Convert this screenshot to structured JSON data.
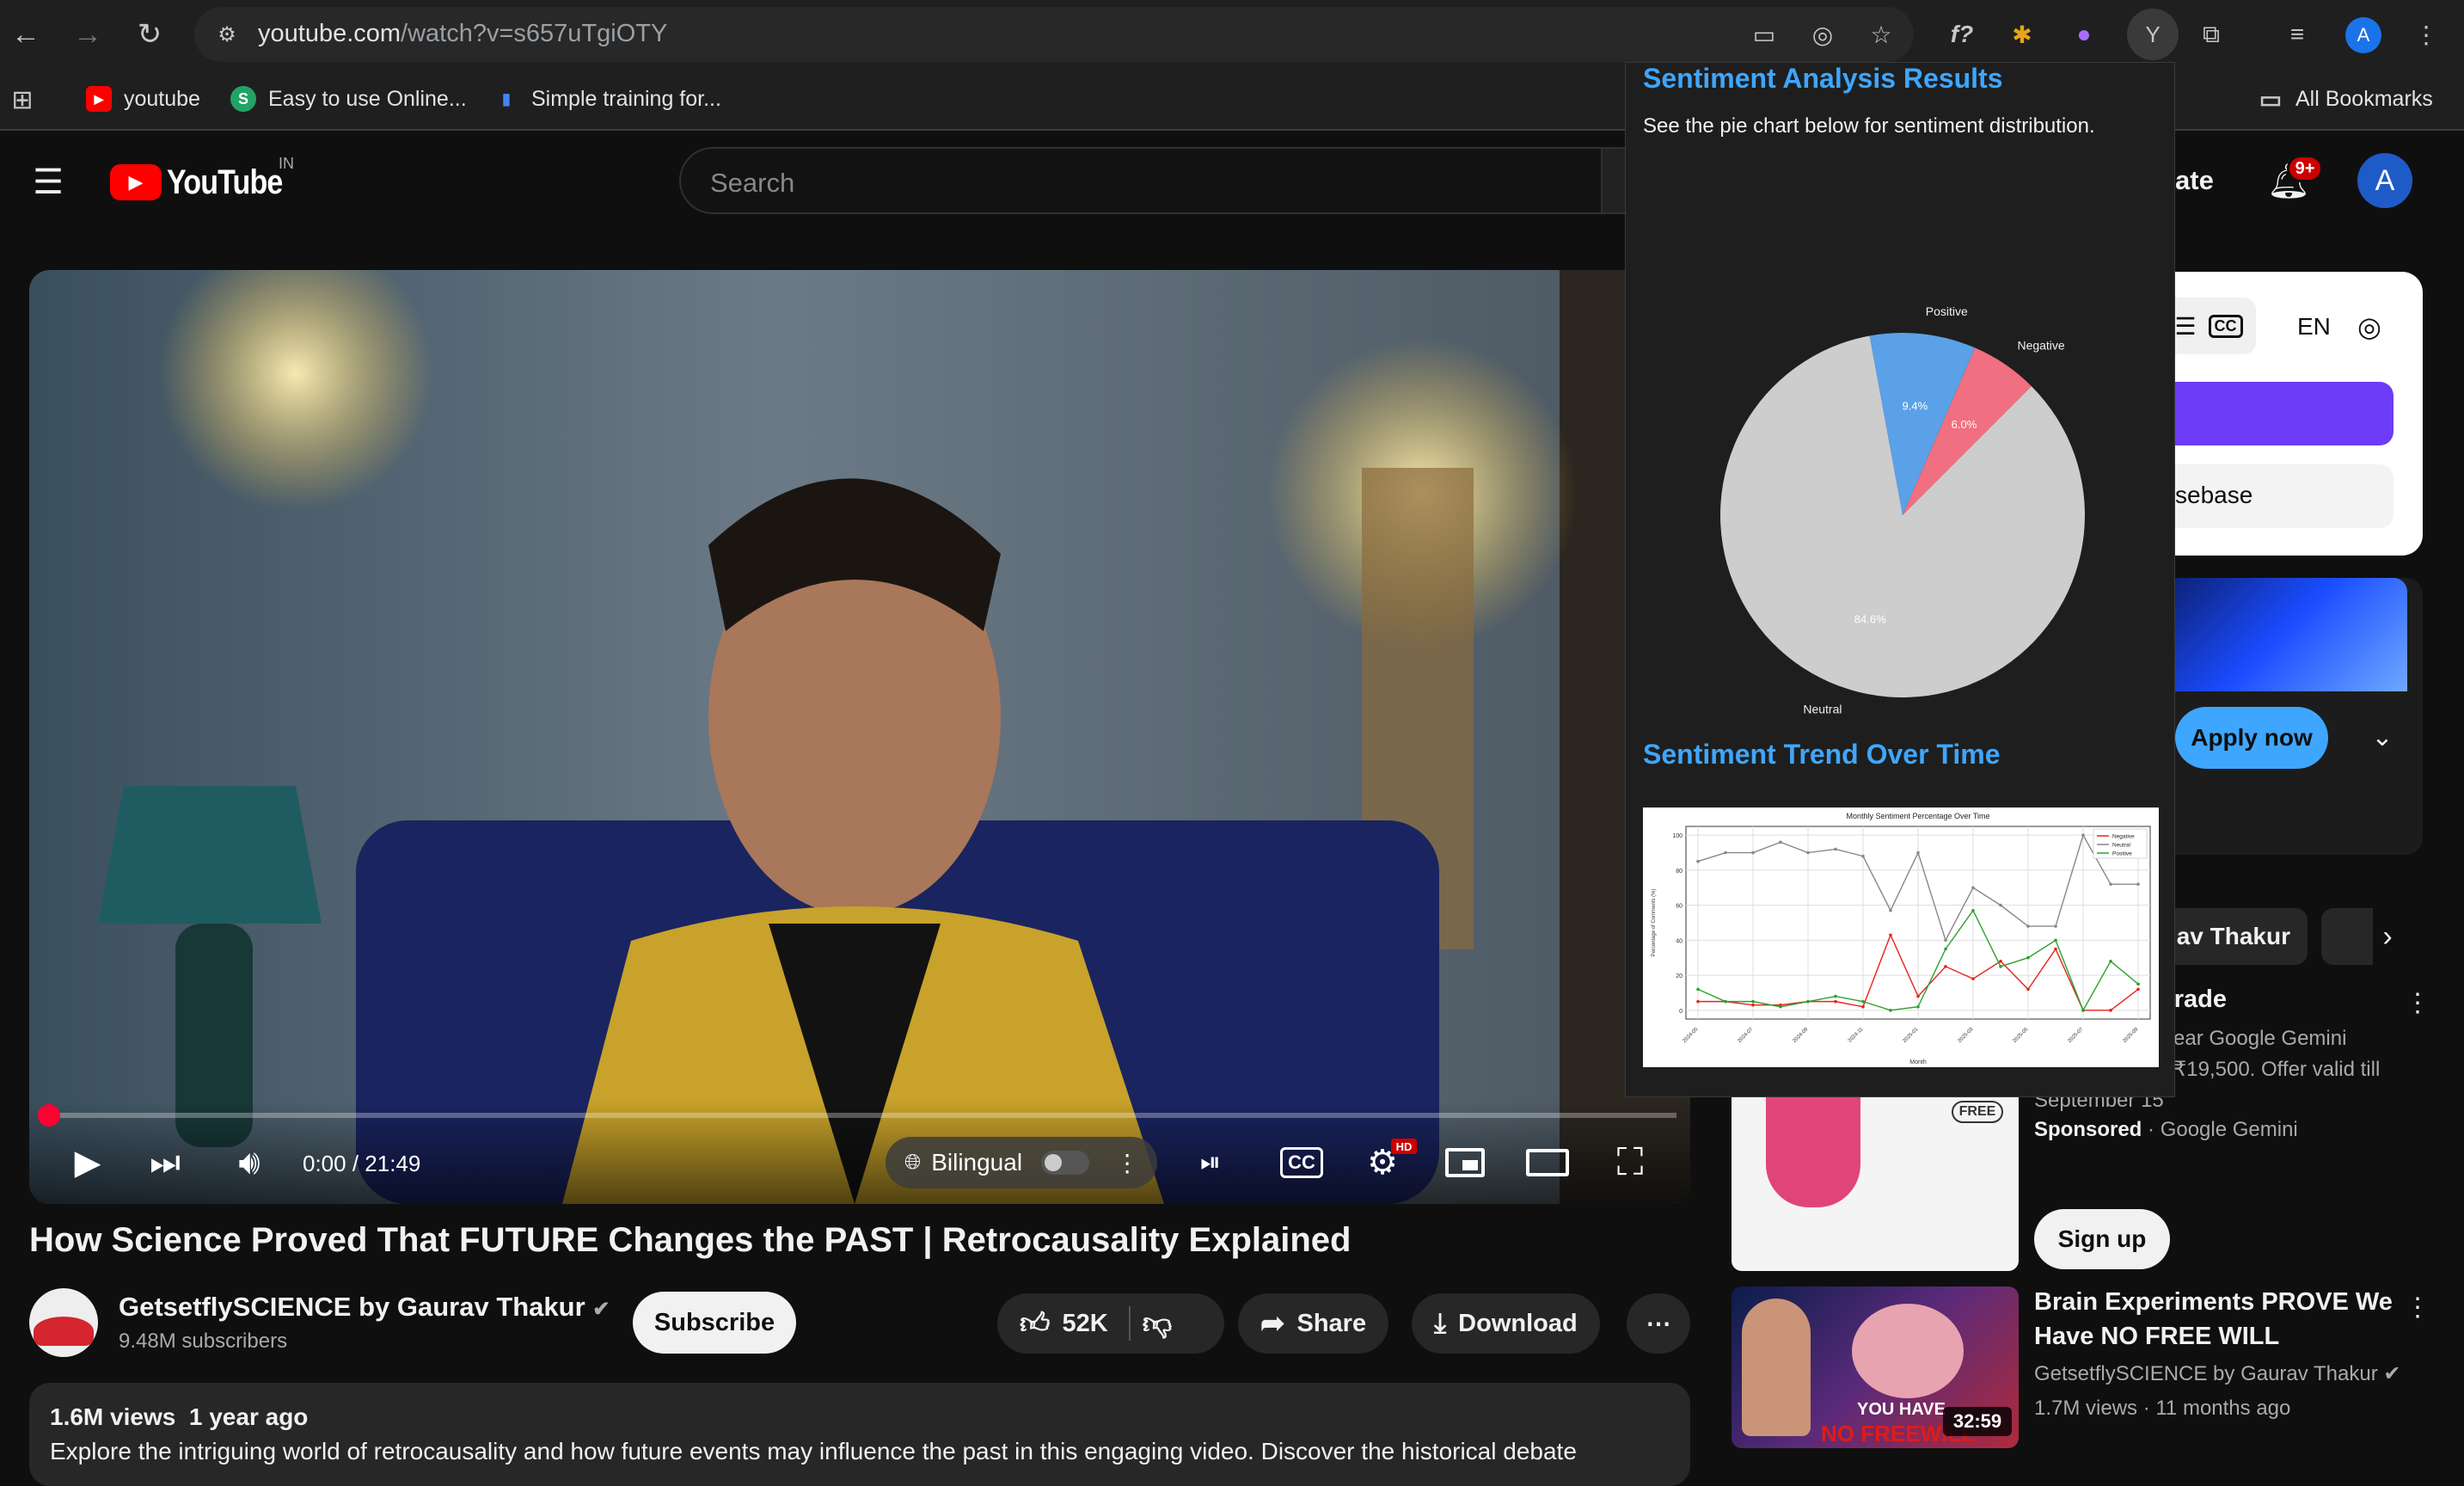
{
  "browser": {
    "url_host": "youtube.com",
    "url_path": "/watch?v=s657uTgiOTY",
    "profile_initial": "A",
    "extension_letter": "Y"
  },
  "bookmarks": {
    "items": [
      {
        "label": "youtube",
        "icon": "youtube-icon"
      },
      {
        "label": "Easy to use Online...",
        "icon": "s-logo-icon"
      },
      {
        "label": "Simple training for...",
        "icon": "bar-logo-icon"
      }
    ],
    "all_bookmarks": "All Bookmarks"
  },
  "yt": {
    "logo_text": "YouTube",
    "region": "IN",
    "search_placeholder": "Search",
    "create_label": "ate",
    "notif_count": "9+",
    "avatar": "A"
  },
  "player": {
    "time": "0:00 / 21:49",
    "bilingual": "Bilingual",
    "hd_badge": "HD",
    "progress": 0.0
  },
  "video": {
    "title": "How Science Proved That FUTURE Changes the PAST | Retrocausality Explained",
    "channel": "GetsetflySCIENCE by Gaurav Thakur",
    "subscribers": "9.48M subscribers",
    "subscribe": "Subscribe",
    "likes": "52K",
    "share": "Share",
    "download": "Download",
    "views": "1.6M views",
    "age": "1 year ago",
    "description": "Explore the intriguing world of retrocausality and how future events may influence the past in this engaging video. Discover the historical debate"
  },
  "extension": {
    "heading": "Sentiment Analysis Results",
    "subtitle": "See the pie chart below for sentiment distribution.",
    "trend_heading": "Sentiment Trend Over Time"
  },
  "chart_data": [
    {
      "type": "pie",
      "categories": [
        "Negative",
        "Positive",
        "Neutral"
      ],
      "values": [
        6.0,
        9.4,
        84.6
      ],
      "labels": [
        "6.0%",
        "9.4%",
        "84.6%"
      ],
      "colors": [
        "#f06f80",
        "#5aa1e8",
        "#cdcdcd"
      ]
    },
    {
      "type": "line",
      "title": "Monthly Sentiment Percentage Over Time",
      "xlabel": "Month",
      "ylabel": "Percentage of Comments (%)",
      "x": [
        "2024-05",
        "2024-06",
        "2024-07",
        "2024-08",
        "2024-09",
        "2024-10",
        "2024-11",
        "2024-12",
        "2025-01",
        "2025-02",
        "2025-03",
        "2025-04",
        "2025-05",
        "2025-06",
        "2025-07",
        "2025-08",
        "2025-09"
      ],
      "x_ticks": [
        "2024-05",
        "2024-07",
        "2024-09",
        "2024-11",
        "2025-01",
        "2025-03",
        "2025-05",
        "2025-07",
        "2025-09"
      ],
      "yticks": [
        0,
        20,
        40,
        60,
        80,
        100
      ],
      "ylim": [
        -5,
        105
      ],
      "legend": "top-right",
      "grid": true,
      "series": [
        {
          "name": "Negative",
          "color": "#e8221e",
          "values": [
            5,
            5,
            3,
            3,
            5,
            5,
            2,
            43,
            8,
            25,
            18,
            28,
            12,
            35,
            0,
            0,
            12
          ]
        },
        {
          "name": "Neutral",
          "color": "#888888",
          "values": [
            85,
            90,
            90,
            96,
            90,
            92,
            88,
            57,
            90,
            40,
            70,
            60,
            48,
            48,
            100,
            72,
            72
          ]
        },
        {
          "name": "Positive",
          "color": "#2ca02c",
          "values": [
            12,
            5,
            5,
            2,
            5,
            8,
            5,
            0,
            2,
            35,
            57,
            25,
            30,
            40,
            0,
            28,
            15
          ]
        }
      ]
    }
  ],
  "sidebar": {
    "lang": "EN",
    "codebase_label": "sebase",
    "apply_now": "Apply now",
    "chip_label": "av Thakur",
    "ad": {
      "title": "Gemini Upgrade",
      "line1": "ear Google Gemini",
      "line2": "₹19,500. Offer valid till",
      "line3": "September 15",
      "sponsored": "Sponsored",
      "advertiser": "Google Gemini",
      "cta": "Sign up",
      "free_badge": "FREE"
    },
    "rec": {
      "title_line1": "Brain Experiments PROVE We",
      "title_line2": "Have NO FREE WILL",
      "channel": "GetsetflySCIENCE by Gaurav Thakur",
      "stats": "1.7M views · 11 months ago",
      "duration": "32:59",
      "thumb_text1": "YOU HAVE",
      "thumb_text2": "NO FREEWILL"
    }
  }
}
